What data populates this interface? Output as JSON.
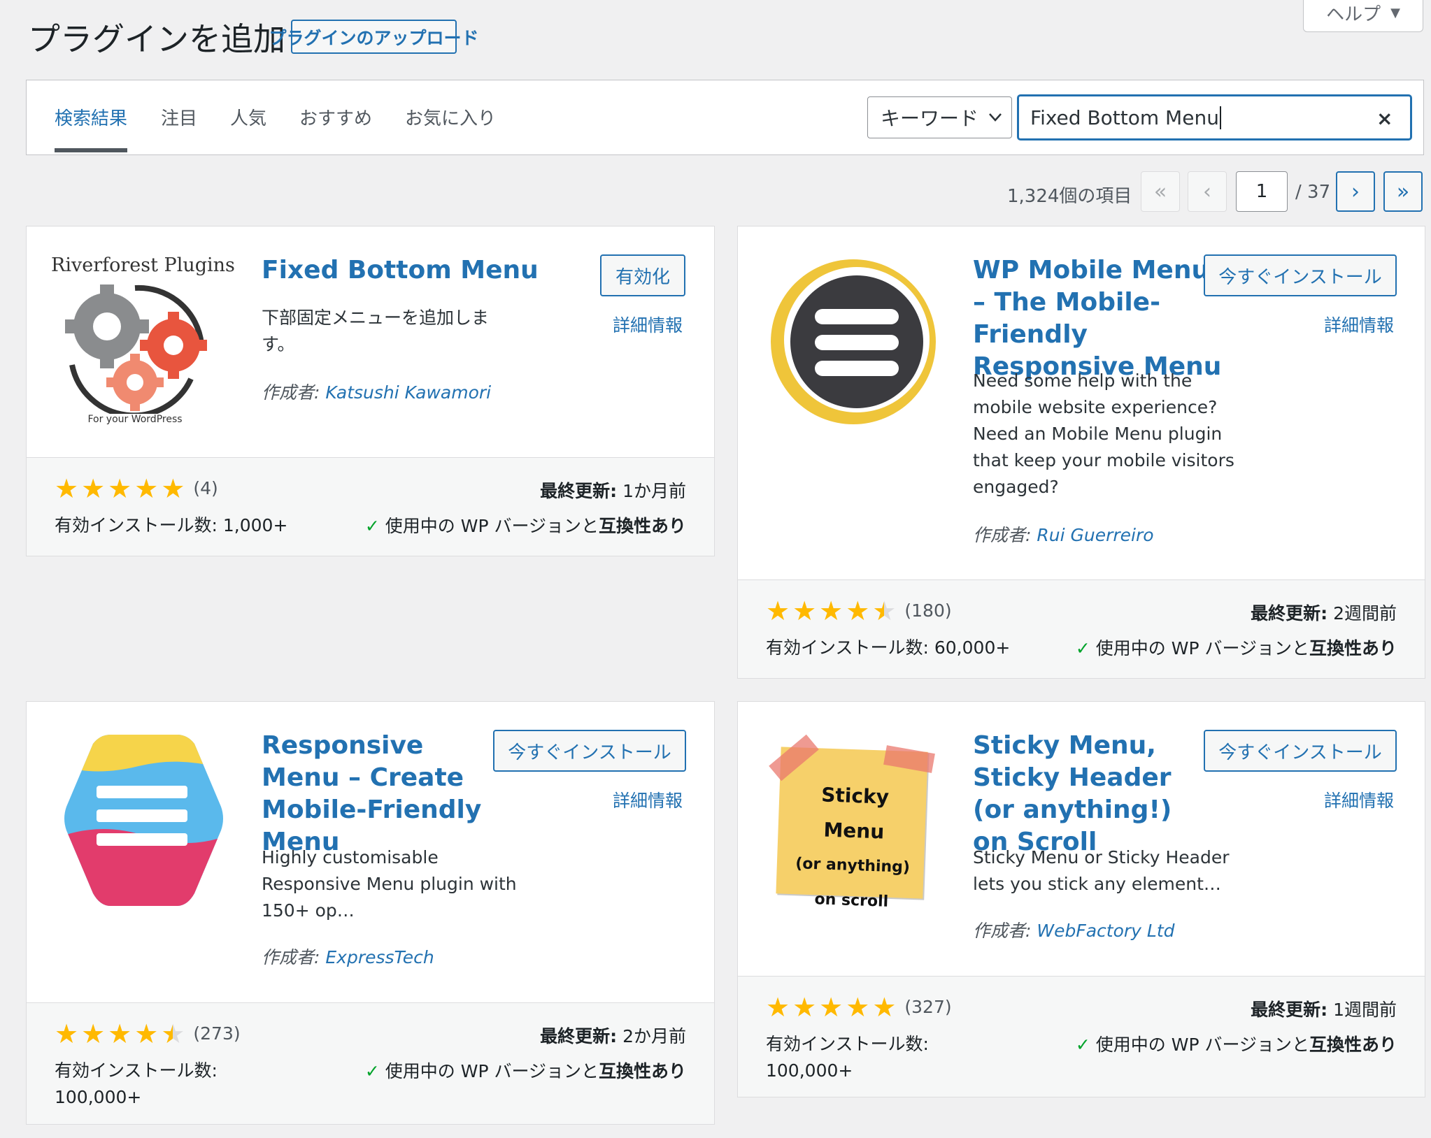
{
  "header": {
    "title": "プラグインを追加",
    "upload_label": "プラグインのアップロード",
    "help_label": "ヘルプ",
    "help_arrow": "▼"
  },
  "tabs": [
    {
      "label": "検索結果",
      "active": true
    },
    {
      "label": "注目",
      "active": false
    },
    {
      "label": "人気",
      "active": false
    },
    {
      "label": "おすすめ",
      "active": false
    },
    {
      "label": "お気に入り",
      "active": false
    }
  ],
  "search": {
    "type_label": "キーワード",
    "query": "Fixed Bottom Menu",
    "clear_icon": "×"
  },
  "pagination": {
    "count_label": "1,324個の項目",
    "first": "«",
    "prev": "‹",
    "current": "1",
    "total": "/ 37",
    "next": "›",
    "last": "»"
  },
  "labels": {
    "more_details": "詳細情報",
    "author_prefix": "作成者:",
    "updated_prefix": "最終更新:",
    "compat_prefix": "使用中の WP バージョンと",
    "compat_strong": "互換性あり",
    "check": "✓"
  },
  "plugins": [
    {
      "name": "Fixed Bottom Menu",
      "description": "下部固定メニューを追加します。",
      "author": "Katsushi Kawamori",
      "action": "有効化",
      "rating": 5,
      "rating_count": "(4)",
      "updated": "1か月前",
      "installs": "有効インストール数: 1,000+",
      "icon": {
        "name": "riverforest-gears-icon",
        "title": "Riverforest Plugins",
        "subtitle": "For your WordPress"
      }
    },
    {
      "name": "WP Mobile Menu – The Mobile-Friendly Responsive Menu",
      "description": "Need some help with the mobile website experience? Need an Mobile Menu plugin that keep your mobile visitors engaged?",
      "author": "Rui Guerreiro",
      "action": "今すぐインストール",
      "rating": 4.5,
      "rating_count": "(180)",
      "updated": "2週間前",
      "installs": "有効インストール数: 60,000+",
      "icon": {
        "name": "hamburger-circle-icon"
      }
    },
    {
      "name": "Responsive Menu – Create Mobile-Friendly Menu",
      "description": "Highly customisable Responsive Menu plugin with 150+ op…",
      "author": "ExpressTech",
      "action": "今すぐインストール",
      "rating": 4.5,
      "rating_count": "(273)",
      "updated": "2か月前",
      "installs": "有効インストール数: 100,000+",
      "icon": {
        "name": "hexagon-menu-icon"
      }
    },
    {
      "name": "Sticky Menu, Sticky Header (or anything!) on Scroll",
      "description": "Sticky Menu or Sticky Header lets you stick any element…",
      "author": "WebFactory Ltd",
      "action": "今すぐインストール",
      "rating": 5,
      "rating_count": "(327)",
      "updated": "1週間前",
      "installs": "有効インストール数: 100,000+",
      "icon": {
        "name": "sticky-note-icon",
        "lines": [
          "Sticky Menu",
          "(or anything)",
          "on scroll"
        ]
      }
    }
  ],
  "colors": {
    "accent": "#2271b1",
    "star": "#ffb900",
    "check": "#00a32a"
  }
}
